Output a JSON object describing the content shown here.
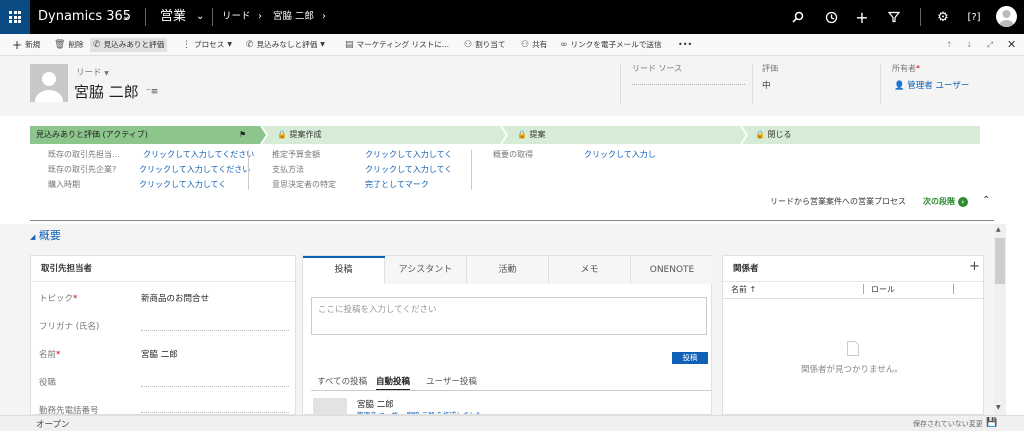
{
  "nav": {
    "app": "Dynamics 365",
    "module": "営業",
    "entity": "リード",
    "record": "宮脇 二郎"
  },
  "commands": [
    {
      "icon": "plus",
      "label": "新規"
    },
    {
      "icon": "trash",
      "label": "削除"
    },
    {
      "icon": "phone-check",
      "label": "見込みありと評価"
    },
    {
      "icon": "process",
      "label": "プロセス"
    },
    {
      "icon": "phone-x",
      "label": "見込みなしと評価"
    },
    {
      "icon": "list",
      "label": "マーケティング リストに..."
    },
    {
      "icon": "assign",
      "label": "割り当て"
    },
    {
      "icon": "share",
      "label": "共有"
    },
    {
      "icon": "link",
      "label": "リンクを電子メールで送信"
    },
    {
      "icon": "more",
      "label": "•••"
    }
  ],
  "header": {
    "entity_label": "リード",
    "name": "宮脇 二郎",
    "lead_source_label": "リード ソース",
    "rating_label": "評価",
    "rating_value": "中",
    "owner_label": "所有者",
    "owner_required": "*",
    "owner_value": "管理者 ユーザー"
  },
  "bpf": {
    "stages": [
      {
        "label": "見込みありと評価 (アクティブ)",
        "active": true
      },
      {
        "label": "提案作成",
        "active": false
      },
      {
        "label": "提案",
        "active": false
      },
      {
        "label": "閉じる",
        "active": false
      }
    ],
    "col1": [
      {
        "label": "既存の取引先担当...",
        "value": "クリックして入力してください"
      },
      {
        "label": "既存の取引先企業?",
        "value": "クリックして入力してください"
      },
      {
        "label": "購入時期",
        "value": "クリックして入力してく"
      }
    ],
    "col2": [
      {
        "label": "推定予算金額",
        "value": "クリックして入力してく"
      },
      {
        "label": "支払方法",
        "value": "クリックして入力してく"
      },
      {
        "label": "意思決定者の特定",
        "value": "完了としてマーク"
      }
    ],
    "col3": [
      {
        "label": "概要の取得",
        "value": "クリックして入力し"
      }
    ],
    "process_name": "リードから営業案件への営業プロセス",
    "next_stage": "次の段階"
  },
  "section": {
    "title": "概要"
  },
  "contact_pane": {
    "title": "取引先担当者",
    "fields": [
      {
        "label": "トピック",
        "required": "*",
        "value": "新商品のお問合せ"
      },
      {
        "label": "フリガナ (氏名)",
        "required": "",
        "value": ""
      },
      {
        "label": "名前",
        "required": "*",
        "value": "宮脇 二郎"
      },
      {
        "label": "役職",
        "required": "",
        "value": ""
      },
      {
        "label": "勤務先電話番号",
        "required": "",
        "value": ""
      }
    ]
  },
  "social": {
    "tabs": [
      "投稿",
      "アシスタント",
      "活動",
      "メモ",
      "ONENOTE"
    ],
    "placeholder": "ここに投稿を入力してください",
    "post_button": "投稿",
    "filters": [
      "すべての投稿",
      "自動投稿",
      "ユーザー投稿"
    ],
    "post_author": "宮脇 二郎",
    "post_text": "管理者 ユーザー 宮脇 二郎 を作成しました"
  },
  "stakeholders": {
    "title": "関係者",
    "col_name": "名前 ↑",
    "col_role": "ロール",
    "empty": "関係者が見つかりません。"
  },
  "status": {
    "state": "オープン",
    "unsaved": "保存されていない変更"
  },
  "colors": {
    "active_stage": "#8cc68c",
    "inactive_stage": "#d6ecd6",
    "link": "#1160b7",
    "primary_button": "#1160b7"
  }
}
